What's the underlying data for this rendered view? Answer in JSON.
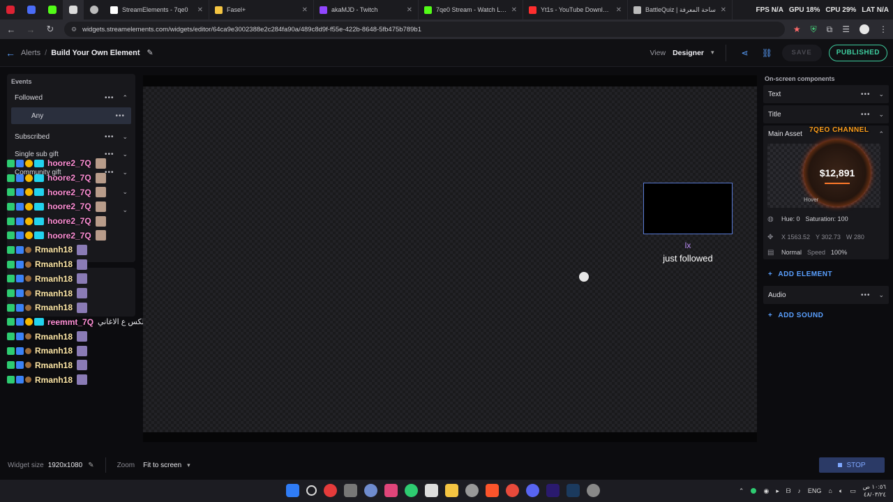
{
  "browser": {
    "mini_tabs": [
      "tab-1",
      "tab-2",
      "tab-3",
      "tab-4",
      "tab-5"
    ],
    "tabs": [
      {
        "title": "StreamElements - 7qe0",
        "color": "#ffffff",
        "active": false
      },
      {
        "title": "Fasel+",
        "color": "#f5c542",
        "active": false
      },
      {
        "title": "akaMJD - Twitch",
        "color": "#9146ff",
        "active": false
      },
      {
        "title": "7qe0 Stream - Watch Live on",
        "color": "#53fc18",
        "active": false
      },
      {
        "title": "Yt1s - YouTube Downloader",
        "color": "#ff2e2e",
        "active": false
      },
      {
        "title": "BattleQuiz | ساحة المعرفة",
        "color": "#bbbbbb",
        "active": false
      }
    ],
    "perf": {
      "fps": "FPS N/A",
      "gpu": "GPU 18%",
      "cpu": "CPU 29%",
      "lat": "LAT N/A"
    },
    "url": "widgets.streamelements.com/widgets/editor/64ca9e3002388e2c284fa90a/489c8d9f-f55e-422b-8648-5fb475b789b1"
  },
  "header": {
    "crumb_root": "Alerts",
    "crumb_sep": "/",
    "crumb_current": "Build Your Own Element",
    "view_label": "View",
    "view_value": "Designer",
    "save_label": "SAVE",
    "publish_label": "PUBLISHED"
  },
  "events": {
    "heading": "Events",
    "items": [
      {
        "label": "Followed"
      },
      {
        "label": "Subscribed"
      },
      {
        "label": "Single sub gift"
      },
      {
        "label": "Community gift"
      }
    ],
    "sub_item": "Any"
  },
  "chat": [
    {
      "name": "hoore2_7Q",
      "style": "pink",
      "msg": ""
    },
    {
      "name": "hoore2_7Q",
      "style": "pink",
      "msg": ""
    },
    {
      "name": "hoore2_7Q",
      "style": "pink",
      "msg": ""
    },
    {
      "name": "hoore2_7Q",
      "style": "pink",
      "msg": ""
    },
    {
      "name": "hoore2_7Q",
      "style": "pink",
      "msg": ""
    },
    {
      "name": "hoore2_7Q",
      "style": "pink",
      "msg": ""
    },
    {
      "name": "Rmanh18",
      "style": "yellow",
      "msg": ""
    },
    {
      "name": "Rmanh18",
      "style": "yellow",
      "msg": ""
    },
    {
      "name": "Rmanh18",
      "style": "yellow",
      "msg": ""
    },
    {
      "name": "Rmanh18",
      "style": "yellow",
      "msg": ""
    },
    {
      "name": "Rmanh18",
      "style": "yellow",
      "msg": ""
    },
    {
      "name": "reemmt_7Q",
      "style": "pink",
      "msg": "اكلكس ع الاغاني"
    },
    {
      "name": "Rmanh18",
      "style": "yellow",
      "msg": ""
    },
    {
      "name": "Rmanh18",
      "style": "yellow",
      "msg": ""
    },
    {
      "name": "Rmanh18",
      "style": "yellow",
      "msg": ""
    },
    {
      "name": "Rmanh18",
      "style": "yellow",
      "msg": ""
    }
  ],
  "canvas": {
    "alert_name": "lx",
    "alert_text": "just followed"
  },
  "components": {
    "heading": "On-screen components",
    "text_label": "Text",
    "title_label": "Title",
    "main_asset_label": "Main Asset",
    "channel_tag": "7QEO CHANNEL",
    "preview_value": "$12,891",
    "hover_label": "Hover",
    "hue": "Hue: 0",
    "saturation": "Saturation: 100",
    "x": "X 1563.52",
    "y": "Y 302.73",
    "w": "W 280",
    "blend": "Normal",
    "speed_label": "Speed",
    "speed_value": "100%",
    "add_element": "ADD ELEMENT",
    "audio_label": "Audio",
    "add_sound": "ADD SOUND"
  },
  "bottom": {
    "widget_size_label": "Widget size",
    "widget_size_value": "1920x1080",
    "zoom_label": "Zoom",
    "zoom_value": "Fit to screen",
    "stop_label": "STOP"
  },
  "taskbar": {
    "lang": "ENG",
    "time": "١٠:٥٦ ص",
    "date": "٤٨/٠٣/٢٤"
  }
}
